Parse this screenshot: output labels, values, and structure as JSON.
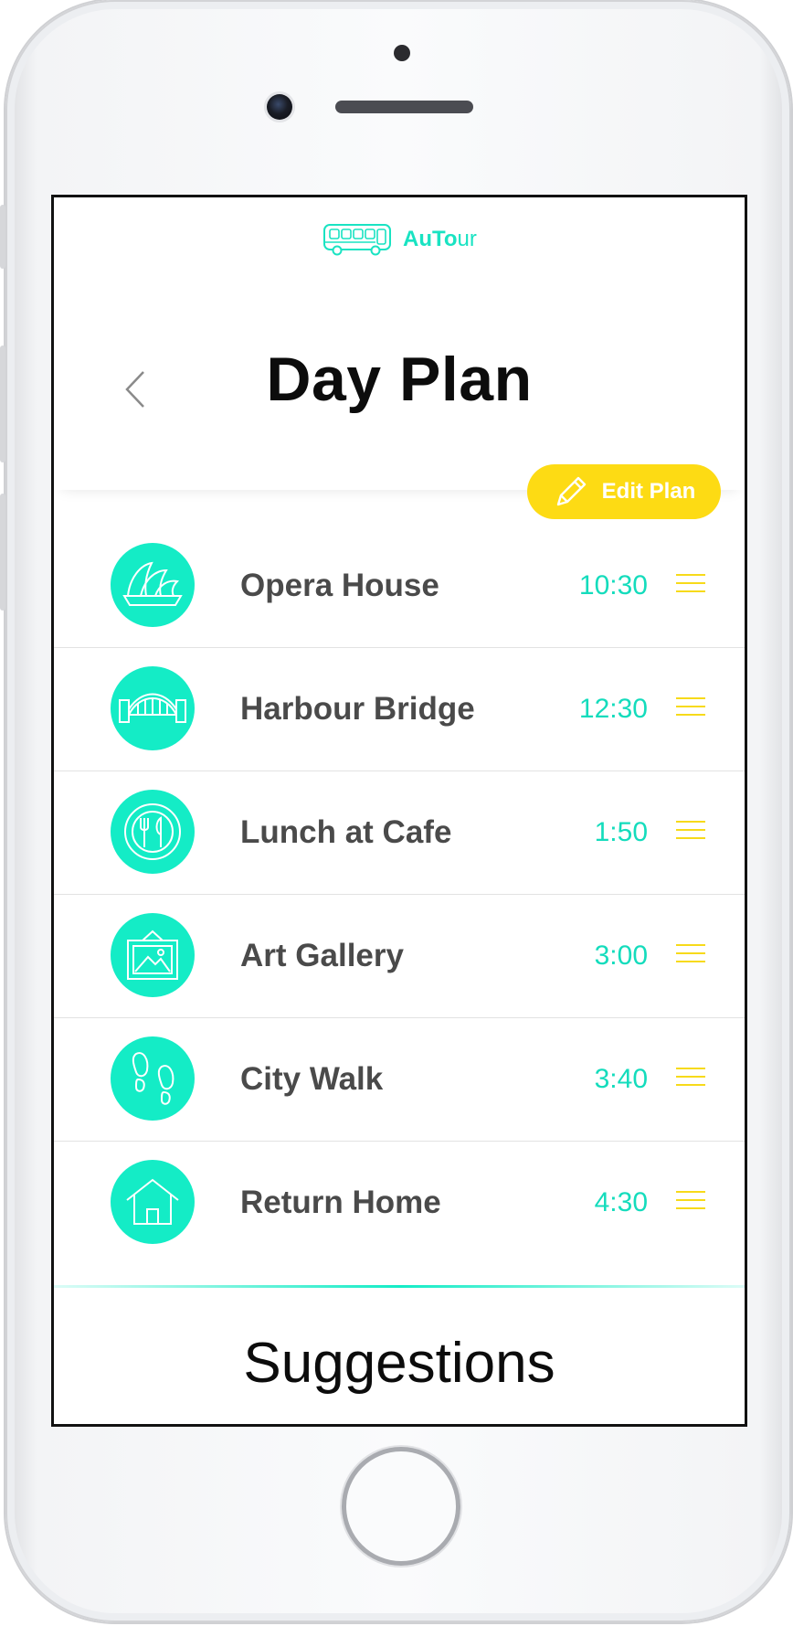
{
  "app": {
    "brand_bold": "AuTo",
    "brand_light": "ur"
  },
  "header": {
    "title": "Day Plan",
    "edit_label": "Edit Plan"
  },
  "plan": [
    {
      "name": "Opera House",
      "time": "10:30",
      "icon": "opera-house-icon"
    },
    {
      "name": "Harbour Bridge",
      "time": "12:30",
      "icon": "bridge-icon"
    },
    {
      "name": "Lunch at Cafe",
      "time": "1:50",
      "icon": "plate-cutlery-icon"
    },
    {
      "name": "Art Gallery",
      "time": "3:00",
      "icon": "picture-frame-icon"
    },
    {
      "name": "City Walk",
      "time": "3:40",
      "icon": "footprints-icon"
    },
    {
      "name": "Return Home",
      "time": "4:30",
      "icon": "house-icon"
    }
  ],
  "section": {
    "suggestions": "Suggestions"
  },
  "colors": {
    "accent": "#14ecc6",
    "highlight": "#fddb14",
    "text": "#4a4a4a"
  }
}
